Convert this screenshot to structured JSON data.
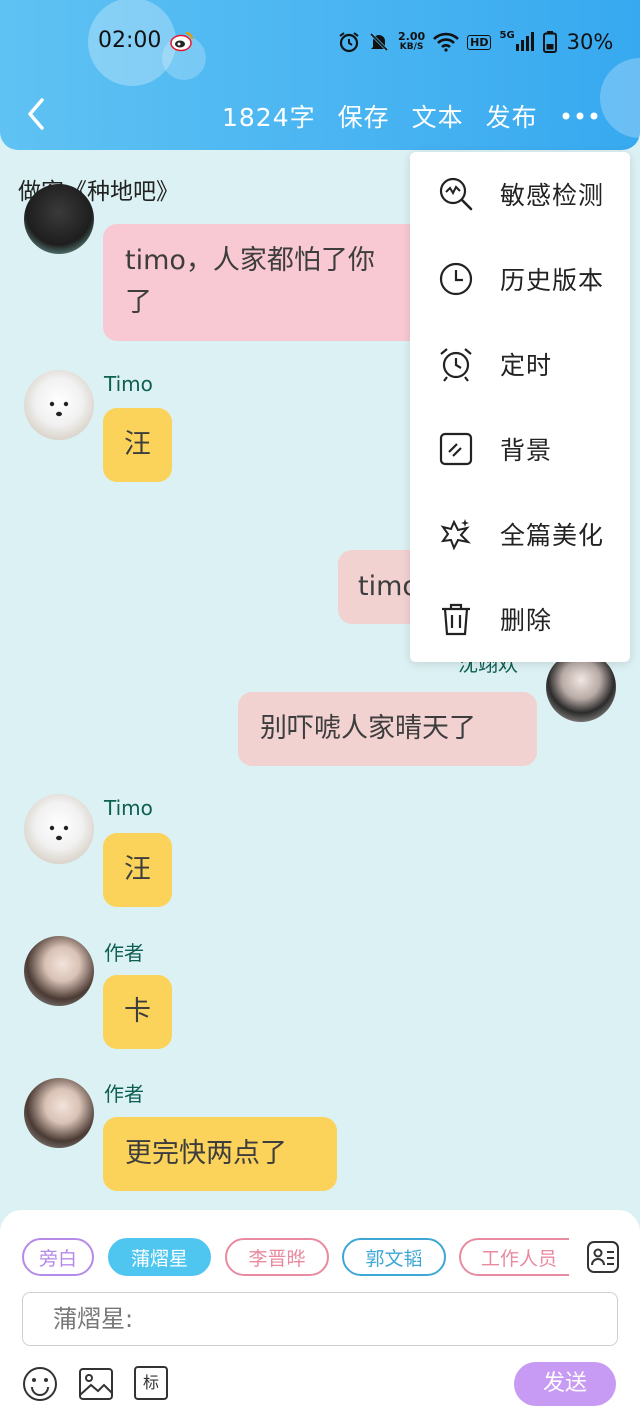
{
  "status_bar": {
    "time": "02:00",
    "net_speed_value": "2.00",
    "net_speed_unit": "KB/S",
    "hd_label": "HD",
    "signal_label": "5G",
    "battery": "30%"
  },
  "toolbar": {
    "word_count": "1824字",
    "save": "保存",
    "text": "文本",
    "publish": "发布"
  },
  "story_title": "做客《种地吧》",
  "messages": [
    {
      "name": "",
      "text": "timo，人家都怕了你",
      "text_line2": "了",
      "color": "#f8c9d2"
    },
    {
      "name": "Timo",
      "text": "汪",
      "color": "#fbd35a"
    },
    {
      "name": "",
      "text": "timo",
      "color": "#f2d1d1"
    },
    {
      "name": "沈翊欢",
      "text": "别吓唬人家晴天了",
      "color": "#f2d1d1"
    },
    {
      "name": "Timo",
      "text": "汪",
      "color": "#fbd35a"
    },
    {
      "name": "作者",
      "text": "卡",
      "color": "#fbd35a"
    },
    {
      "name": "作者",
      "text": "更完快两点了",
      "color": "#fbd35a"
    }
  ],
  "menu": {
    "items": [
      {
        "label": "敏感检测",
        "icon": "sensitive-check-icon"
      },
      {
        "label": "历史版本",
        "icon": "clock-icon"
      },
      {
        "label": "定时",
        "icon": "alarm-icon"
      },
      {
        "label": "背景",
        "icon": "background-icon"
      },
      {
        "label": "全篇美化",
        "icon": "beautify-icon"
      },
      {
        "label": "删除",
        "icon": "trash-icon"
      }
    ]
  },
  "roles": [
    {
      "label": "旁白",
      "color": "#b58ae8"
    },
    {
      "label": "蒲熠星",
      "color": "#4fc6ef",
      "selected": true
    },
    {
      "label": "李晋晔",
      "color": "#e98aa0"
    },
    {
      "label": "郭文韬",
      "color": "#3fa7d6"
    },
    {
      "label": "工作人员",
      "color": "#e98aa0"
    }
  ],
  "input": {
    "placeholder": "蒲熠星:"
  },
  "bottom": {
    "tag_label": "标",
    "send_label": "发送"
  },
  "colors": {
    "header": "#37a9f0",
    "background": "#dcf1f3",
    "send": "#c79af3"
  }
}
